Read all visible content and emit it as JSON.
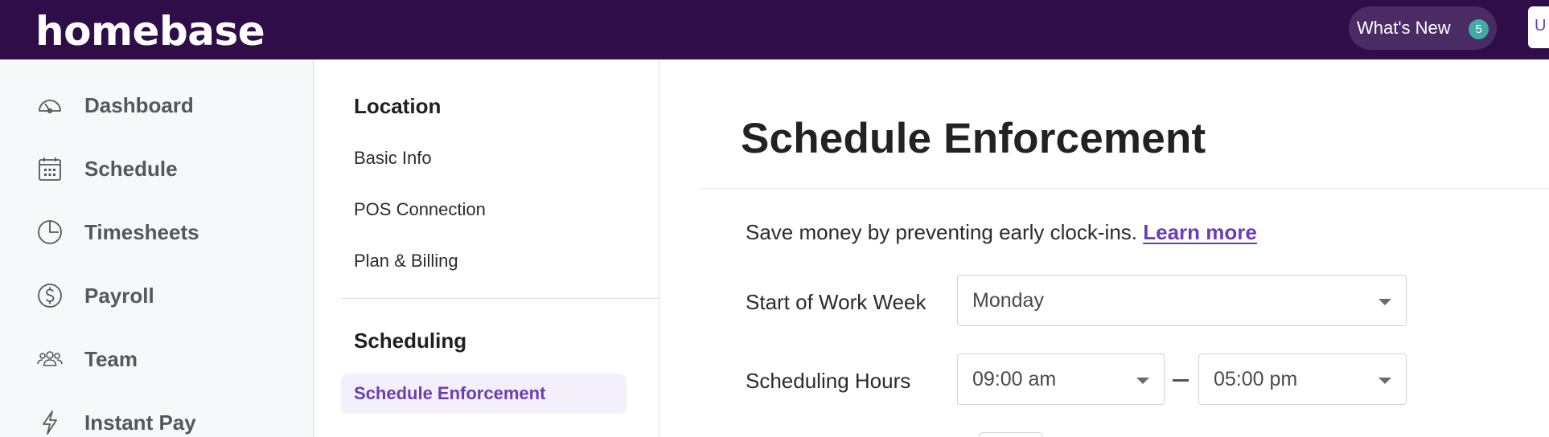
{
  "header": {
    "logo": "homebase",
    "whats_new_label": "What's New",
    "whats_new_count": "5",
    "edge_button_label": "U"
  },
  "sidebar": {
    "items": [
      {
        "label": "Dashboard",
        "icon": "dashboard-gauge-icon"
      },
      {
        "label": "Schedule",
        "icon": "calendar-icon"
      },
      {
        "label": "Timesheets",
        "icon": "clock-pie-icon"
      },
      {
        "label": "Payroll",
        "icon": "dollar-circle-icon"
      },
      {
        "label": "Team",
        "icon": "team-people-icon"
      },
      {
        "label": "Instant Pay",
        "icon": "lightning-icon"
      }
    ]
  },
  "subnav": {
    "location_heading": "Location",
    "location_items": [
      "Basic Info",
      "POS Connection",
      "Plan & Billing"
    ],
    "scheduling_heading": "Scheduling",
    "active_item": "Schedule Enforcement"
  },
  "main": {
    "title": "Schedule Enforcement",
    "intro_text": "Save money by preventing early clock-ins.",
    "learn_more": "Learn more",
    "start_of_week_label": "Start of Work Week",
    "start_of_week_value": "Monday",
    "scheduling_hours_label": "Scheduling Hours",
    "hours_start": "09:00 am",
    "hours_end": "05:00 pm"
  },
  "colors": {
    "topbar": "#2e0d48",
    "accent": "#6b3db5",
    "badge": "#3faba3",
    "sidebar_bg": "#f7f8fa"
  }
}
